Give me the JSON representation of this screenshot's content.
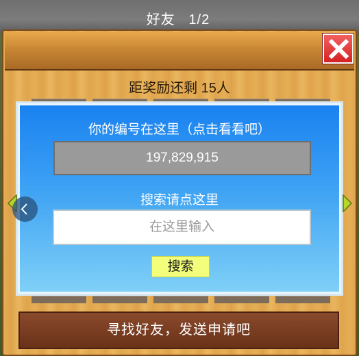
{
  "dialog": {
    "title": "好友",
    "page": "1/2",
    "reward_text": "距奖励还剩 15人"
  },
  "my_id": {
    "label": "你的编号在这里（点击看看吧）",
    "value": "197,829,915"
  },
  "search": {
    "label": "搜索请点这里",
    "placeholder": "在这里输入",
    "button_label": "搜索"
  },
  "send_button_label": "寻找好友，发送申请吧",
  "icons": {
    "close": "close-x-icon",
    "prev_page": "arrow-left-icon",
    "next_page": "arrow-right-icon",
    "back": "chevron-left-icon"
  },
  "colors": {
    "panel_wood": "#e5ae55",
    "header_wood": "#c98735",
    "board_blue": "#1a82f0",
    "close_red": "#d52222",
    "search_button": "#f3ff7a",
    "send_button": "#6a3119",
    "arrow_green": "#b6d62a"
  }
}
